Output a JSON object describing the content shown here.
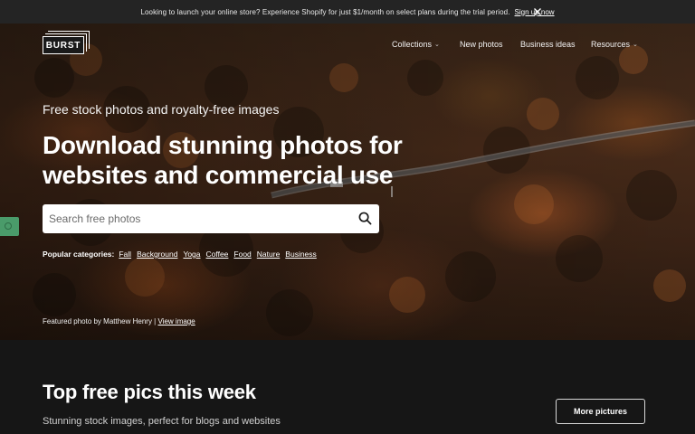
{
  "announcement": {
    "message": "Looking to launch your online store? Experience Shopify for just $1/month on select plans during the trial period.",
    "signup_label": "Sign up now"
  },
  "logo": {
    "text": "BURST"
  },
  "nav": {
    "items": [
      {
        "label": "Collections",
        "has_dropdown": true
      },
      {
        "label": "New photos",
        "has_dropdown": false
      },
      {
        "label": "Business ideas",
        "has_dropdown": false
      },
      {
        "label": "Resources",
        "has_dropdown": true
      }
    ]
  },
  "hero": {
    "eyebrow": "Free stock photos and royalty-free images",
    "headline": "Download stunning photos for websites and commercial use",
    "search": {
      "placeholder": "Search free photos",
      "value": ""
    },
    "popular": {
      "label": "Popular categories:",
      "categories": [
        "Fall",
        "Background",
        "Yoga",
        "Coffee",
        "Food",
        "Nature",
        "Business"
      ]
    },
    "credit": {
      "text": "Featured photo by Matthew Henry |",
      "link": "View image"
    }
  },
  "top_pics": {
    "title": "Top free pics this week",
    "subtitle": "Stunning stock images, perfect for blogs and websites",
    "more_button": "More pictures"
  },
  "colors": {
    "announcement_bg": "#242424",
    "page_bg": "#161616",
    "side_tab": "#4a9b6a"
  }
}
